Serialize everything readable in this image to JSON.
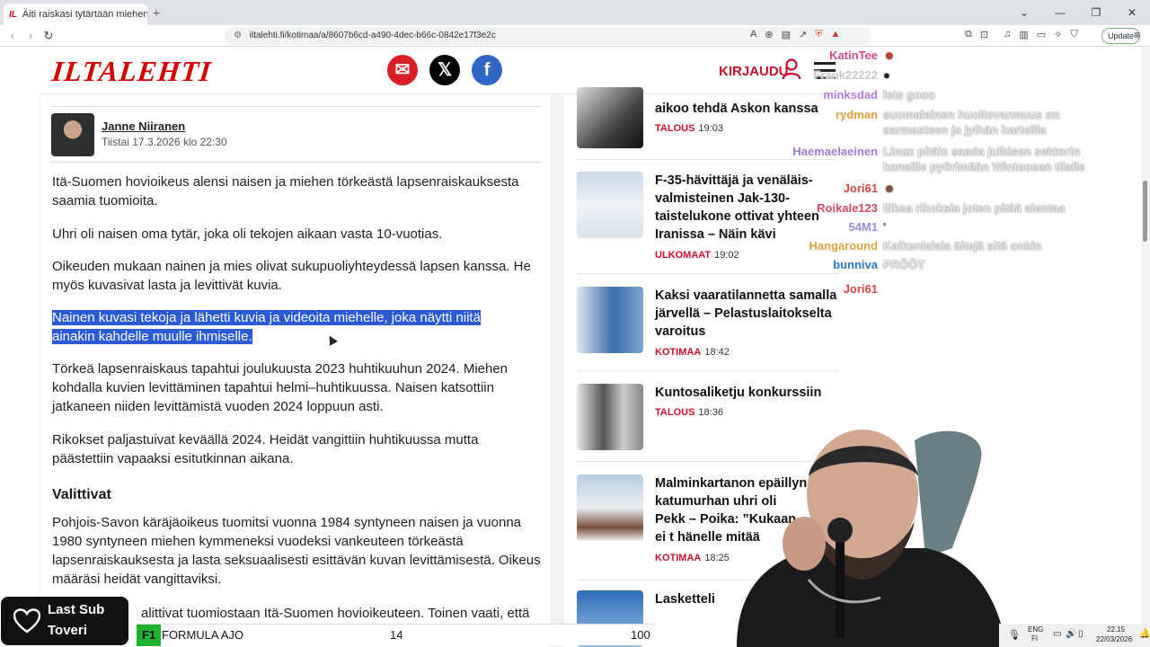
{
  "browser": {
    "tab_title": "Äiti raiskasi tytärtään miehen ka",
    "tab_favicon": "IL",
    "url": "iltalehti.fi/kotimaa/a/8607b6cd-a490-4dec-b66c-0842e17f3e2c",
    "update_label": "Update"
  },
  "header": {
    "logo": "ILTALEHTI",
    "login": "KIRJAUDU"
  },
  "article": {
    "author": "Janne Niiranen",
    "date": "Tiistai 17.3.2026 klo 22:30",
    "p1": "Itä-Suomen hovioikeus alensi naisen ja miehen törkeästä lapsenraiskauksesta saamia tuomioita.",
    "p2": "Uhri oli naisen oma tytär, joka oli tekojen aikaan vasta 10-vuotias.",
    "p3": "Oikeuden mukaan nainen ja mies olivat sukupuoliyhteydessä lapsen kanssa. He myös kuvasivat lasta ja levittivät kuvia.",
    "p4a": "Nainen kuvasi tekoja ja lähetti kuvia ja videoita miehelle, joka näytti niitä",
    "p4b": "ainakin kahdelle muulle ihmiselle.",
    "p5": "Törkeä lapsenraiskaus tapahtui joulukuusta 2023 huhtikuuhun 2024. Miehen kohdalla kuvien levittäminen tapahtui helmi–huhtikuussa. Naisen katsottiin jatkaneen niiden levittämistä vuoden 2024 loppuun asti.",
    "p6": "Rikokset paljastuivat keväällä 2024. Heidät vangittiin huhtikuussa mutta päästettiin vapaaksi esitutkinnan aikana.",
    "heading": "Valittivat",
    "p7": "Pohjois-Savon käräjäoikeus tuomitsi vuonna 1984 syntyneen naisen ja vuonna 1980 syntyneen miehen kymmeneksi vuodeksi vankeuteen törkeästä lapsenraiskauksesta ja lasta seksuaalisesti esittävän kuvan levittämisestä. Oikeus määräsi heidät vangittaviksi.",
    "p8": "alittivat tuomiostaan Itä-Suomen hovioikeuteen. Toinen vaati, että"
  },
  "news": [
    {
      "title_l1": "aikoo tehdä Askon kanssa",
      "category": "TALOUS",
      "time": "19:03"
    },
    {
      "title": "F-35-hävittäjä ja venäläis-valmisteinen Jak-130-taistelukone ottivat yhteen Iranissa – Näin kävi",
      "category": "ULKOMAAT",
      "time": "19:02"
    },
    {
      "title": "Kaksi vaaratilannetta samalla järvellä – Pelastuslaitokselta varoitus",
      "category": "KOTIMAA",
      "time": "18:42"
    },
    {
      "title": "Kuntosaliketju konkurssiin",
      "category": "TALOUS",
      "time": "18:36"
    },
    {
      "title": "Malminkartanon epäillyn katumurhan uhri oli Pekk – Poika: ”Kukaan ei t hänelle mitää",
      "category": "KOTIMAA",
      "time": "18:25"
    },
    {
      "title": "Lasketteli",
      "category": "",
      "time": ""
    }
  ],
  "chat": [
    {
      "user": "KatinTee",
      "color": "#d44a8a",
      "msg": ""
    },
    {
      "user": "Frank22222",
      "color": "#bbbbbb",
      "msg": ""
    },
    {
      "user": "minksdad",
      "color": "#b57ad8",
      "msg": "lets gooo"
    },
    {
      "user": "rydman",
      "color": "#e0a23a",
      "msg": "suomalainen huoltovarmuus on sarmasteen ja jylhän harteilla"
    },
    {
      "user": "Haemaelaeinen",
      "color": "#a47ad8",
      "msg": "Linux pitäis saada julkisen sektorin koneille pyörimään Wintoosan tilalle"
    },
    {
      "user": "Jori61",
      "color": "#d64848",
      "msg": ""
    },
    {
      "user": "Roikale123",
      "color": "#d44a6a",
      "msg": "liikaa rikoksia joten pitää alentaa"
    },
    {
      "user": "54M1",
      "color": "#9a8ae0",
      "msg": ""
    },
    {
      "user": "Hangaround",
      "color": "#e0a23a",
      "msg": "Kaikenlaisia äitejä sitä onkin"
    },
    {
      "user": "bunniva",
      "color": "#2a78d0",
      "msg": "PRÖÖT"
    },
    {
      "user": "Jori61",
      "color": "#d64848",
      "msg": ""
    }
  ],
  "overlay": {
    "lastsub_line1": "Last Sub",
    "lastsub_line2": "Toveri",
    "ticker_tag": "F1",
    "ticker_text": "FORMULA AJO",
    "ticker_num1": "14",
    "ticker_num2": "100"
  },
  "taskbar": {
    "lang1": "ENG",
    "lang2": "FI",
    "time": "22.15",
    "date": "22/03/2026"
  }
}
